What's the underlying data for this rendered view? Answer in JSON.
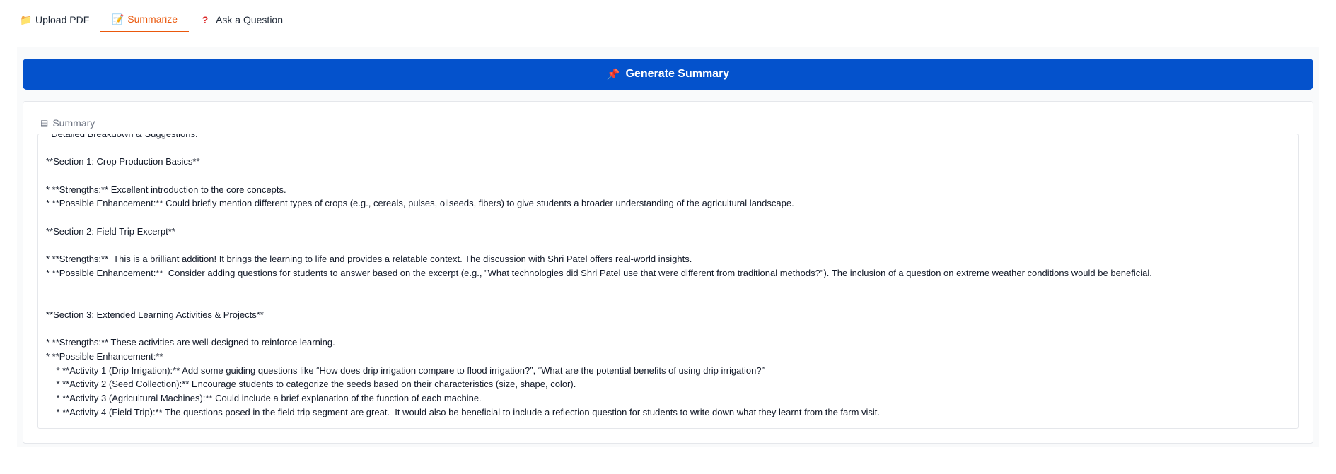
{
  "tabs": [
    {
      "icon": "folder-icon",
      "label": "Upload PDF",
      "active": false
    },
    {
      "icon": "memo-icon",
      "label": "Summarize",
      "active": true
    },
    {
      "icon": "question-icon",
      "label": "Ask a Question",
      "active": false
    }
  ],
  "generate_button": {
    "label": "Generate Summary",
    "icon": "pushpin-icon"
  },
  "summary": {
    "label": "Summary",
    "lines": [
      "  Detailed Breakdown & Suggestions:",
      "",
      "**Section 1: Crop Production Basics**",
      "",
      "* **Strengths:** Excellent introduction to the core concepts.",
      "* **Possible Enhancement:** Could briefly mention different types of crops (e.g., cereals, pulses, oilseeds, fibers) to give students a broader understanding of the agricultural landscape.",
      "",
      "**Section 2: Field Trip Excerpt**",
      "",
      "* **Strengths:**  This is a brilliant addition! It brings the learning to life and provides a relatable context. The discussion with Shri Patel offers real-world insights.",
      "* **Possible Enhancement:**  Consider adding questions for students to answer based on the excerpt (e.g., \"What technologies did Shri Patel use that were different from traditional methods?\"). The inclusion of a question on extreme weather conditions would be beneficial.",
      "",
      "",
      "**Section 3: Extended Learning Activities & Projects**",
      "",
      "* **Strengths:** These activities are well-designed to reinforce learning.",
      "* **Possible Enhancement:**",
      "    * **Activity 1 (Drip Irrigation):** Add some guiding questions like “How does drip irrigation compare to flood irrigation?”, “What are the potential benefits of using drip irrigation?”",
      "    * **Activity 2 (Seed Collection):** Encourage students to categorize the seeds based on their characteristics (size, shape, color).",
      "    * **Activity 3 (Agricultural Machines):** Could include a brief explanation of the function of each machine.",
      "    * **Activity 4 (Field Trip):** The questions posed in the field trip segment are great.  It would also be beneficial to include a reflection question for students to write down what they learnt from the farm visit."
    ]
  },
  "colors": {
    "accent": "#ea580c",
    "primary_button": "#0452cc"
  }
}
